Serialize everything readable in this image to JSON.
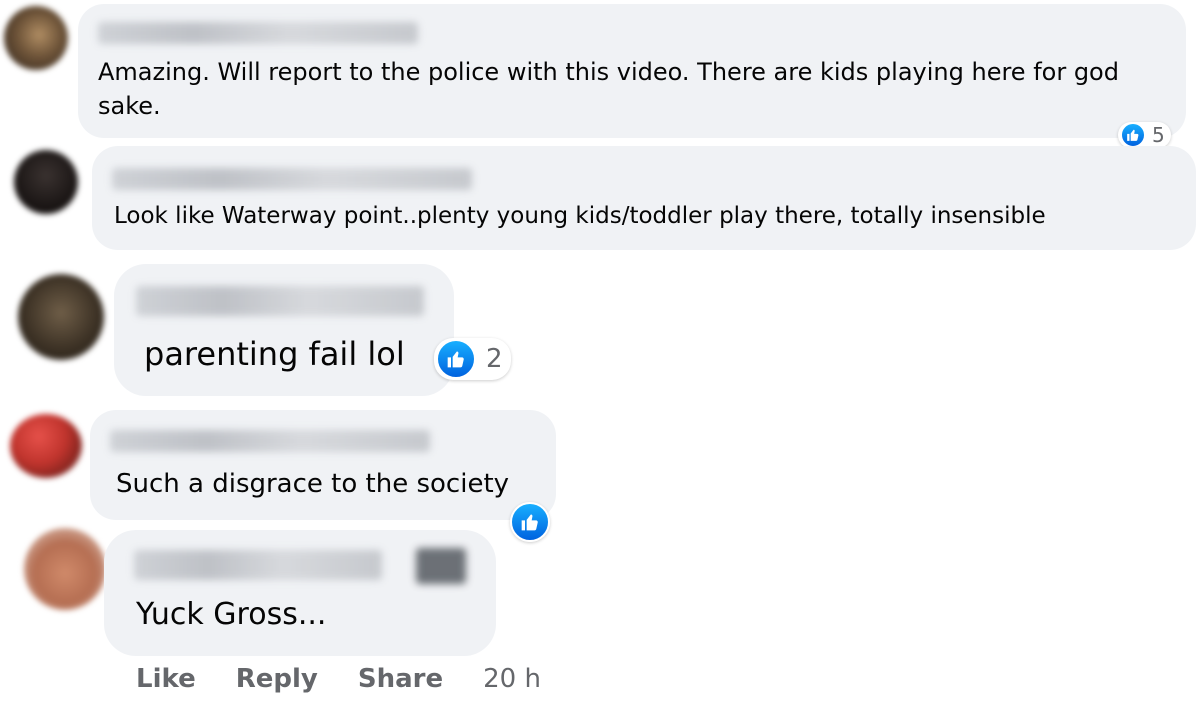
{
  "comments": [
    {
      "text": "Amazing. Will report to the police with this video. There are kids playing here for god\nsake.",
      "reaction_count": "5"
    },
    {
      "text": "Look like Waterway point..plenty young kids/toddler play there, totally insensible"
    },
    {
      "text": "parenting fail lol",
      "reaction_count": "2"
    },
    {
      "text": "Such a disgrace to the society"
    },
    {
      "text": "Yuck Gross..."
    }
  ],
  "actions": {
    "like": "Like",
    "reply": "Reply",
    "share": "Share",
    "time": "20 h"
  },
  "colors": {
    "bubble": "#f0f2f5",
    "like_blue": "#1877f2",
    "secondary_text": "#65676b"
  },
  "icons": {
    "reaction": "thumbs-up-icon"
  }
}
